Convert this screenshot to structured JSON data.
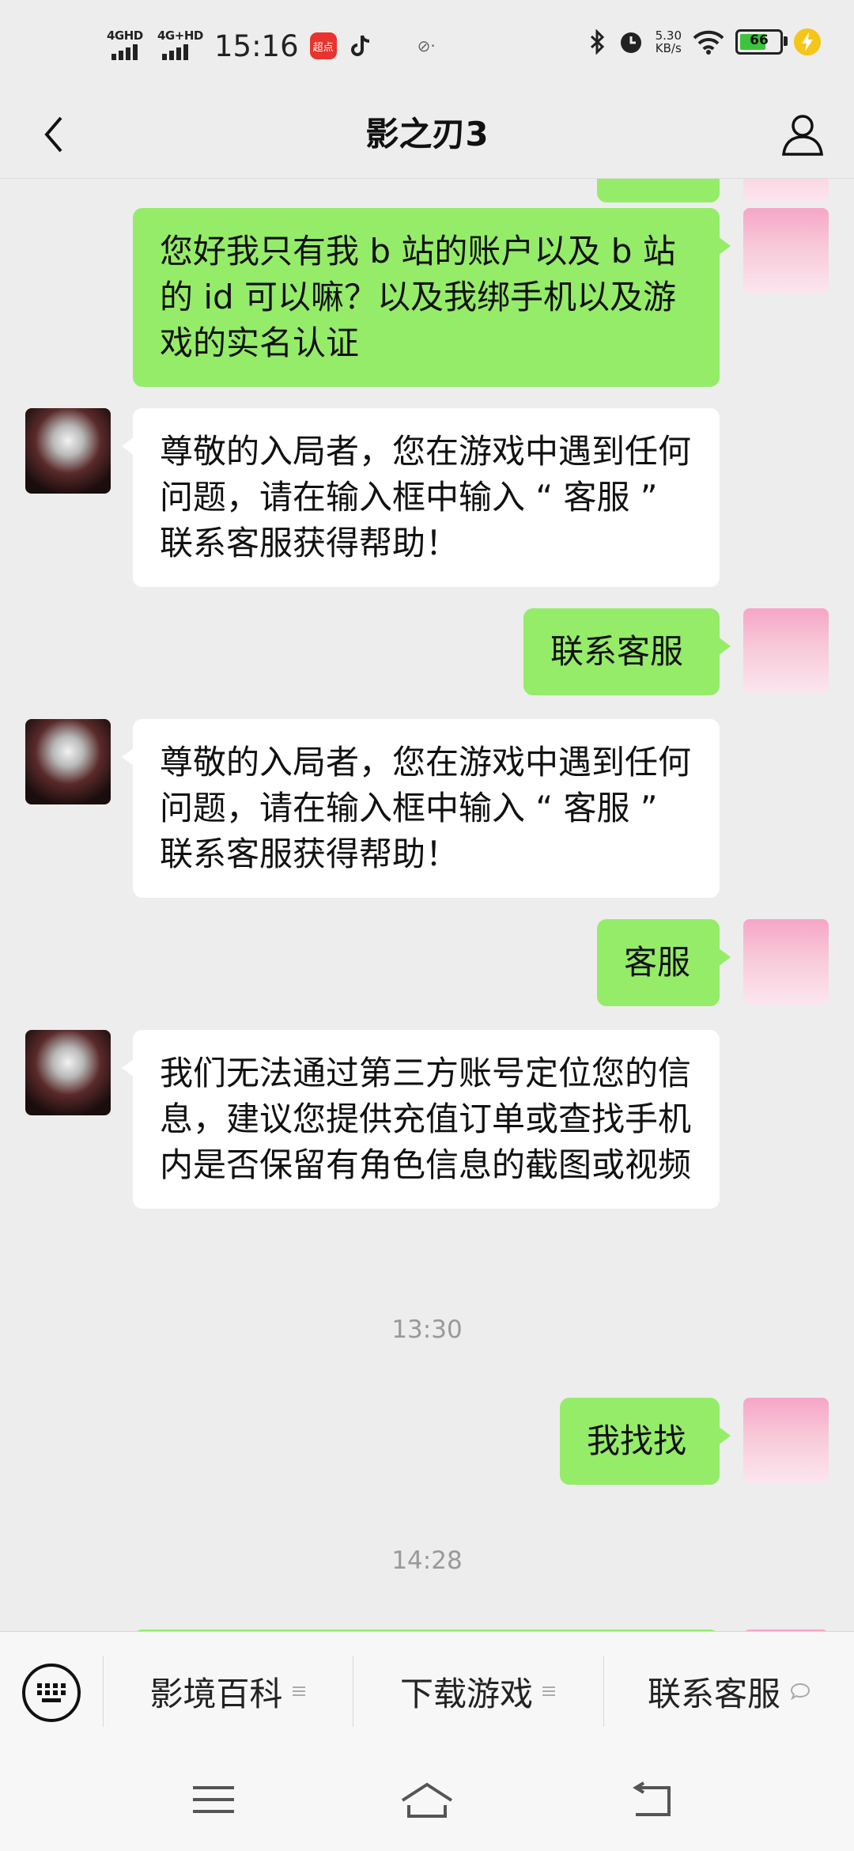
{
  "status_bar": {
    "network1": "4GHD",
    "network2": "4G+HD",
    "time": "15:16",
    "app_badge": "超点",
    "speed_value": "5.30",
    "speed_unit": "KB/s",
    "battery": "66"
  },
  "header": {
    "title": "影之刃3"
  },
  "messages": [
    {
      "from": "me",
      "text": "您好我只有我 b 站的账户以及 b 站的 id 可以嘛？以及我绑手机以及游戏的实名认证"
    },
    {
      "from": "bot",
      "text": "尊敬的入局者，您在游戏中遇到任何问题，请在输入框中输入 “ 客服 ” 联系客服获得帮助！"
    },
    {
      "from": "me",
      "text": "联系客服"
    },
    {
      "from": "bot",
      "text": "尊敬的入局者，您在游戏中遇到任何问题，请在输入框中输入 “ 客服 ” 联系客服获得帮助！"
    },
    {
      "from": "me",
      "text": "客服"
    },
    {
      "from": "bot",
      "text": "我们无法通过第三方账号定位您的信息，建议您提供充值订单或查找手机内是否保留有角色信息的截图或视频"
    },
    {
      "from": "me",
      "text": "我找找"
    }
  ],
  "timestamps": [
    "13:30",
    "14:28"
  ],
  "menu": {
    "items": [
      {
        "label": "影境百科",
        "icon": "list-icon"
      },
      {
        "label": "下载游戏",
        "icon": "list-icon"
      },
      {
        "label": "联系客服",
        "icon": "chat-bubble-icon"
      }
    ]
  },
  "colors": {
    "my_bubble": "#95ec69",
    "bot_bubble": "#ffffff",
    "background": "#ededed",
    "battery_fill": "#3ec33e"
  }
}
